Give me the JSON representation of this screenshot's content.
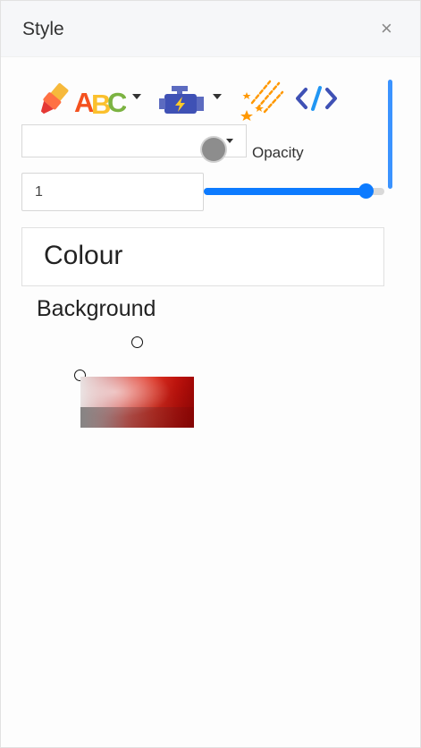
{
  "panel": {
    "title": "Style",
    "close_icon": "×"
  },
  "toolbar": {
    "icons": [
      "highlighter-icon",
      "text-abc-icon",
      "engine-icon",
      "shooting-stars-icon",
      "code-icon"
    ]
  },
  "font_select": {
    "value": ""
  },
  "opacity": {
    "label": "Opacity",
    "value": "1",
    "slider_level": 0.9
  },
  "colour_section": {
    "title": "Colour",
    "background_label": "Background"
  },
  "colors": {
    "accent": "#0d7bff",
    "color_dot": "#8d8d8d",
    "scrollbar": "#3b93ff"
  }
}
